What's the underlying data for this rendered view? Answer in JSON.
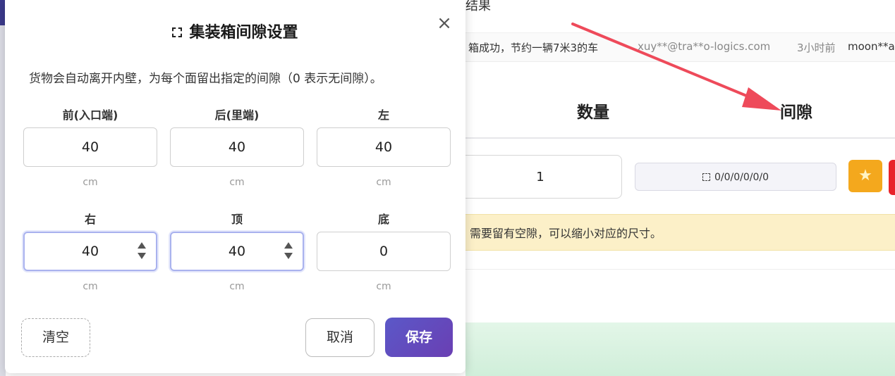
{
  "background": {
    "header_fragment": "结果",
    "notice": {
      "message": "箱成功，节约一辆7米3的车",
      "email": "xuy**@tra**o-logics.com",
      "time": "3小时前",
      "user": "moon**a"
    },
    "columns": {
      "quantity": "数量",
      "gap": "间隙"
    },
    "row": {
      "quantity_value": "1",
      "gap_value": "0/0/0/0/0/0"
    },
    "warning": "需要留有空隙，可以缩小对应的尺寸。",
    "colors": {
      "star": "#f4a81d",
      "danger": "#e8232a",
      "warning_bg": "#fcf0c8",
      "arrow": "#ee4a5a"
    }
  },
  "dialog": {
    "title": "集装箱间隙设置",
    "description": "货物会自动离开内壁，为每个面留出指定的间隙（0 表示无间隙）。",
    "fields": [
      {
        "label": "前(入口端)",
        "value": "40",
        "unit": "cm",
        "focused": false
      },
      {
        "label": "后(里端)",
        "value": "40",
        "unit": "cm",
        "focused": false
      },
      {
        "label": "左",
        "value": "40",
        "unit": "cm",
        "focused": false
      },
      {
        "label": "右",
        "value": "40",
        "unit": "cm",
        "focused": true
      },
      {
        "label": "顶",
        "value": "40",
        "unit": "cm",
        "focused": true
      },
      {
        "label": "底",
        "value": "0",
        "unit": "cm",
        "focused": false
      }
    ],
    "buttons": {
      "clear": "清空",
      "cancel": "取消",
      "save": "保存"
    },
    "colors": {
      "primary": "#5b58c8",
      "focus_border": "#a9b2ee"
    }
  }
}
